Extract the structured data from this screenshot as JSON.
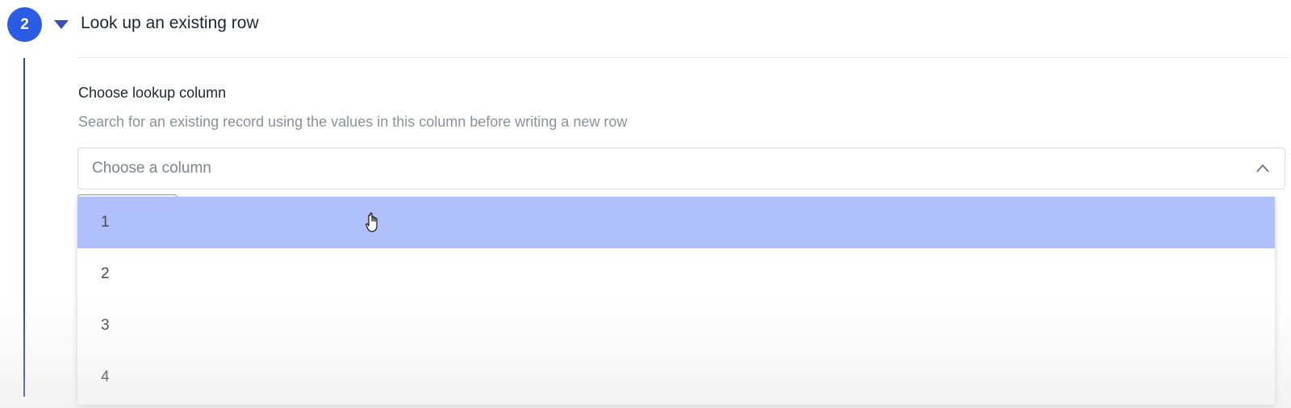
{
  "step": {
    "number": "2",
    "title": "Look up an existing row",
    "icons": {
      "toggle": "caret-down-icon"
    }
  },
  "field": {
    "label": "Choose lookup column",
    "help": "Search for an existing record using the values in this column before writing a new row",
    "placeholder": "Choose a column",
    "icons": {
      "toggle": "chevron-up-icon"
    }
  },
  "dropdown": {
    "options": [
      {
        "label": "1",
        "highlighted": true
      },
      {
        "label": "2",
        "highlighted": false
      },
      {
        "label": "3",
        "highlighted": false
      },
      {
        "label": "4",
        "highlighted": false
      }
    ]
  },
  "colors": {
    "accent": "#2b5ce6",
    "step_line": "#2d45b5",
    "highlight": "#b0c0fb"
  },
  "cursor": "hand-pointer-icon"
}
